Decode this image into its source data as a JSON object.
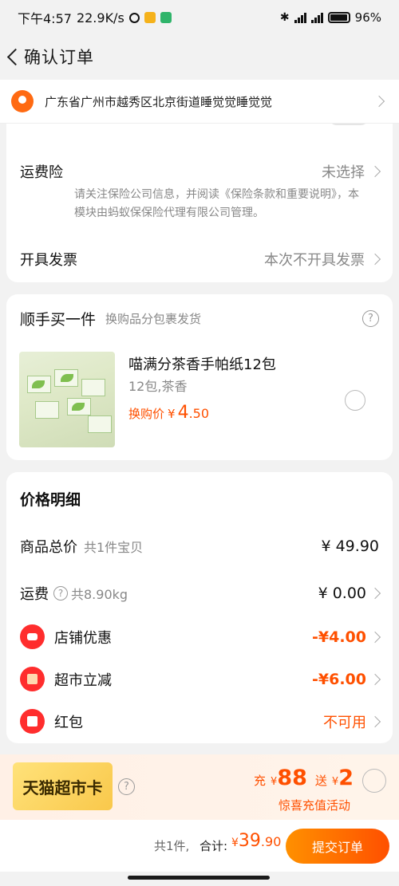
{
  "status_bar": {
    "time": "下午4:57",
    "speed": "22.9K/s",
    "battery": "96%"
  },
  "nav": {
    "title": "确认订单"
  },
  "address": {
    "text": "广东省广州市越秀区北京街道睡觉觉睡觉觉"
  },
  "order_options": {
    "shipping_insurance": {
      "label": "运费险",
      "value": "未选择",
      "note": "请关注保险公司信息，并阅读《保险条款和重要说明》，本模块由蚂蚁保保险代理有限公司管理。"
    },
    "invoice": {
      "label": "开具发票",
      "value": "本次不开具发票"
    }
  },
  "addon": {
    "title": "顺手买一件",
    "subtitle": "换购品分包裹发货",
    "help_icon": "question-icon",
    "product": {
      "name": "喵满分茶香手帕纸12包",
      "spec": "12包,茶香",
      "price_label": "换购价",
      "currency": "¥",
      "price_int": "4",
      "price_dec": ".50"
    }
  },
  "price_detail": {
    "title": "价格明细",
    "rows": [
      {
        "label": "商品总价",
        "sub": "共1件宝贝",
        "amount": "¥ 49.90"
      },
      {
        "label": "运费",
        "sub": "共8.90kg",
        "amount": "¥ 0.00"
      },
      {
        "label": "店铺优惠",
        "amount": "-¥4.00"
      },
      {
        "label": "超市立减",
        "amount": "-¥6.00"
      },
      {
        "label": "红包",
        "amount": "不可用"
      }
    ]
  },
  "promo": {
    "card_name": "天猫超市卡",
    "charge_word": "充",
    "charge_currency": "¥",
    "charge_amount": "88",
    "gift_word": "送",
    "gift_currency": "¥",
    "gift_amount": "2",
    "subtitle": "惊喜充值活动"
  },
  "footer": {
    "count": "共1件,",
    "total_label": "合计:",
    "currency": "¥",
    "total_int": "39",
    "total_dec": ".90",
    "submit_label": "提交订单"
  },
  "colors": {
    "accent": "#ff5000",
    "red_icon": "#ff2d2d",
    "pin": "#ff6a12"
  }
}
